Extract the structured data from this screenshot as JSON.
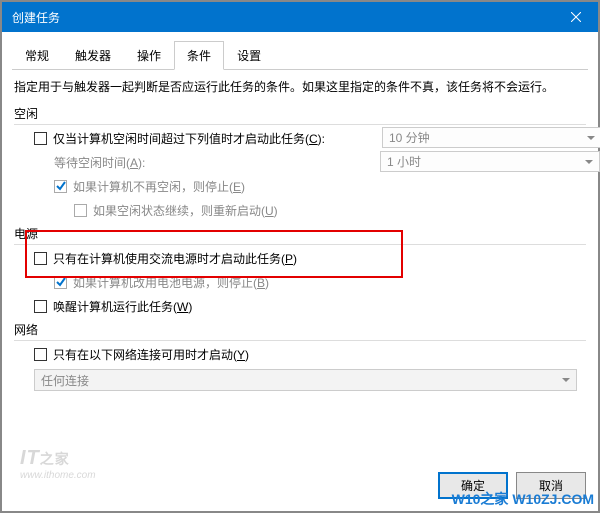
{
  "window": {
    "title": "创建任务"
  },
  "tabs": {
    "items": [
      {
        "label": "常规"
      },
      {
        "label": "触发器"
      },
      {
        "label": "操作"
      },
      {
        "label": "条件"
      },
      {
        "label": "设置"
      }
    ],
    "activeIndex": 3
  },
  "description": "指定用于与触发器一起判断是否应运行此任务的条件。如果这里指定的条件不真，该任务将不会运行。",
  "sections": {
    "idle": {
      "label": "空闲",
      "start": {
        "text": "仅当计算机空闲时间超过下列值时才启动此任务(",
        "accel": "C",
        "suffix": "):"
      },
      "wait": {
        "text": "等待空闲时间(",
        "accel": "A",
        "suffix": "):"
      },
      "stop": {
        "text": "如果计算机不再空闲，则停止(",
        "accel": "E",
        "suffix": ")"
      },
      "restart": {
        "text": "如果空闲状态继续，则重新启动(",
        "accel": "U",
        "suffix": ")"
      },
      "duration": "10 分钟",
      "waitTime": "1 小时"
    },
    "power": {
      "label": "电源",
      "ac": {
        "text": "只有在计算机使用交流电源时才启动此任务(",
        "accel": "P",
        "suffix": ")"
      },
      "battery": {
        "text": "如果计算机改用电池电源，则停止(",
        "accel": "B",
        "suffix": ")"
      },
      "wake": {
        "text": "唤醒计算机运行此任务(",
        "accel": "W",
        "suffix": ")"
      }
    },
    "network": {
      "label": "网络",
      "only": {
        "text": "只有在以下网络连接可用时才启动(",
        "accel": "Y",
        "suffix": ")"
      },
      "conn": "任何连接"
    }
  },
  "buttons": {
    "ok": "确定",
    "cancel": "取消"
  },
  "watermark": {
    "brand": "IT",
    "brandSmall": "之家",
    "url": "www.ithome.com",
    "footer": "W10之家 W10ZJ.COM"
  }
}
